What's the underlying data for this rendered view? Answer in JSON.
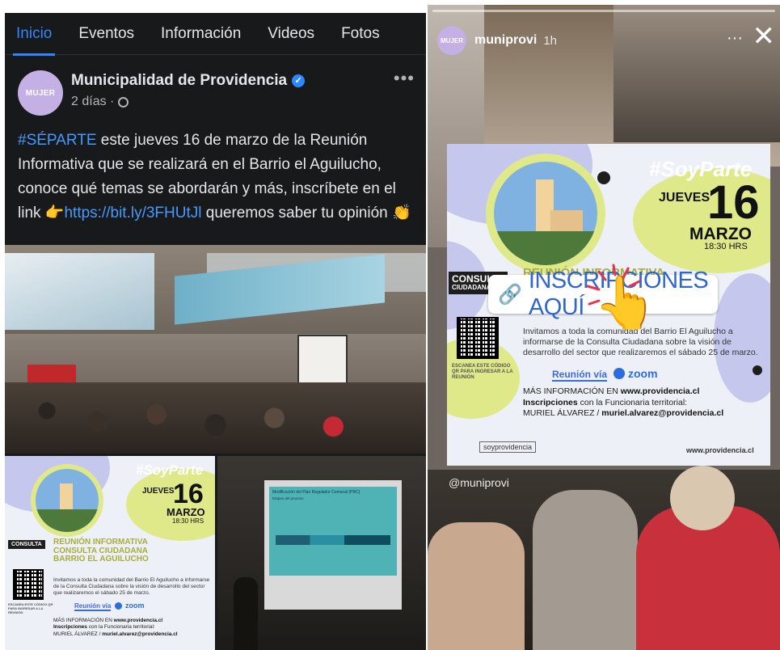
{
  "facebook": {
    "tabs": [
      {
        "label": "Inicio",
        "active": true
      },
      {
        "label": "Eventos",
        "active": false
      },
      {
        "label": "Información",
        "active": false
      },
      {
        "label": "Videos",
        "active": false
      },
      {
        "label": "Fotos",
        "active": false
      }
    ],
    "page_name": "Municipalidad de Providencia",
    "avatar_text": "MUJER",
    "timestamp": "2 días ·",
    "more": "•••",
    "post": {
      "hashtag": "#SÉPARTE",
      "text_1": " este jueves 16 de marzo de la Reunión Informativa que se realizará en el Barrio el Aguilucho, conoce qué temas se abordarán y más, inscríbete en el link ",
      "pointing_emoji": "👉",
      "link": "https://bit.ly/3FHUtJl",
      "text_2": " queremos saber tu opinión ",
      "clap_emoji": "👏"
    }
  },
  "instagram": {
    "username": "muniprovi",
    "time": "1h",
    "dots": "···",
    "close": "✕",
    "mention": "@muniprovi",
    "sticker_label": "INSCRIPCIONES AQUÍ",
    "sticker_icon": "link-icon"
  },
  "flyer": {
    "hashtag": "#SoyParte",
    "day": "JUEVES",
    "number": "16",
    "month": "MARZO",
    "time": "18:30 HRS",
    "title_1": "REUNIÓN INFORMATIVA",
    "title_2": "CONSULTA CIUDADANA",
    "title_3": "BARRIO EL AGUILUCHO",
    "consulta_1": "CONSULTA",
    "consulta_2": "CIUDADANA",
    "body": "Invitamos a toda la comunidad del Barrio El Aguilucho a informarse de la Consulta Ciudadana sobre la visión de desarrollo del sector que realizaremos el sábado 25 de marzo.",
    "reunion_via": "Reunión vía",
    "zoom": "zoom",
    "scan": "ESCANEA ESTE CÓDIGO QR PARA INGRESAR A LA REUNIÓN",
    "info_1_pre": "MÁS INFORMACIÓN EN ",
    "info_1_url": "www.providencia.cl",
    "info_2_pre": "Inscripciones",
    "info_2_post": " con la Funcionaria territorial:",
    "info_3": "MURIEL ÁLVAREZ / ",
    "info_3_mail": "muriel.alvarez@providencia.cl",
    "footer_logo": "soyprovidencia",
    "footer_url": "www.providencia.cl"
  },
  "projection": {
    "title": "Modificación del Plan Regulador Comunal (PRC)",
    "subtitle": "Etapas del proceso"
  }
}
